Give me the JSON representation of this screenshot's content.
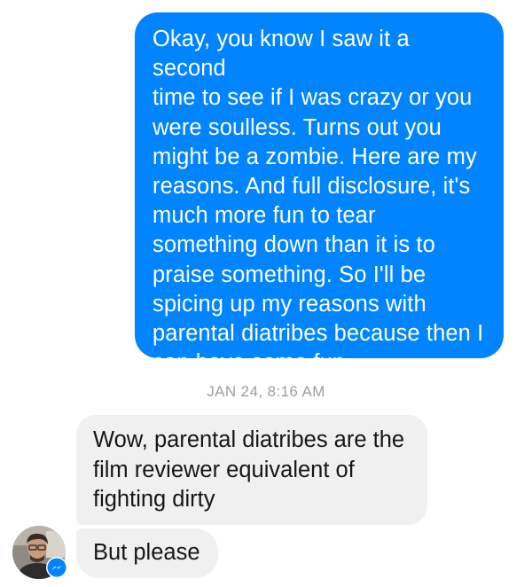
{
  "conversation": {
    "outgoing_message": "Okay, you know I saw it a second\ntime to see if I was crazy or you\nwere soulless. Turns out you\nmight be a zombie. Here are my\nreasons. And full disclosure, it's\nmuch more fun to tear\nsomething down than it is to\npraise something. So I'll be\nspicing up my reasons with\nparental diatribes because then I\ncan have some fun.",
    "timestamp": "JAN 24, 8:16 AM",
    "incoming_messages": [
      {
        "text": "Wow, parental diatribes are the\nfilm reviewer  equivalent of\nfighting dirty"
      },
      {
        "text": "But please"
      }
    ]
  },
  "colors": {
    "outgoing_bubble": "#0084ff",
    "incoming_bubble": "#f1f0f0",
    "timestamp_text": "#9b9ea3",
    "messenger_badge": "#0084ff"
  },
  "icons": {
    "avatar": "user-avatar-photo",
    "badge": "messenger-icon"
  }
}
